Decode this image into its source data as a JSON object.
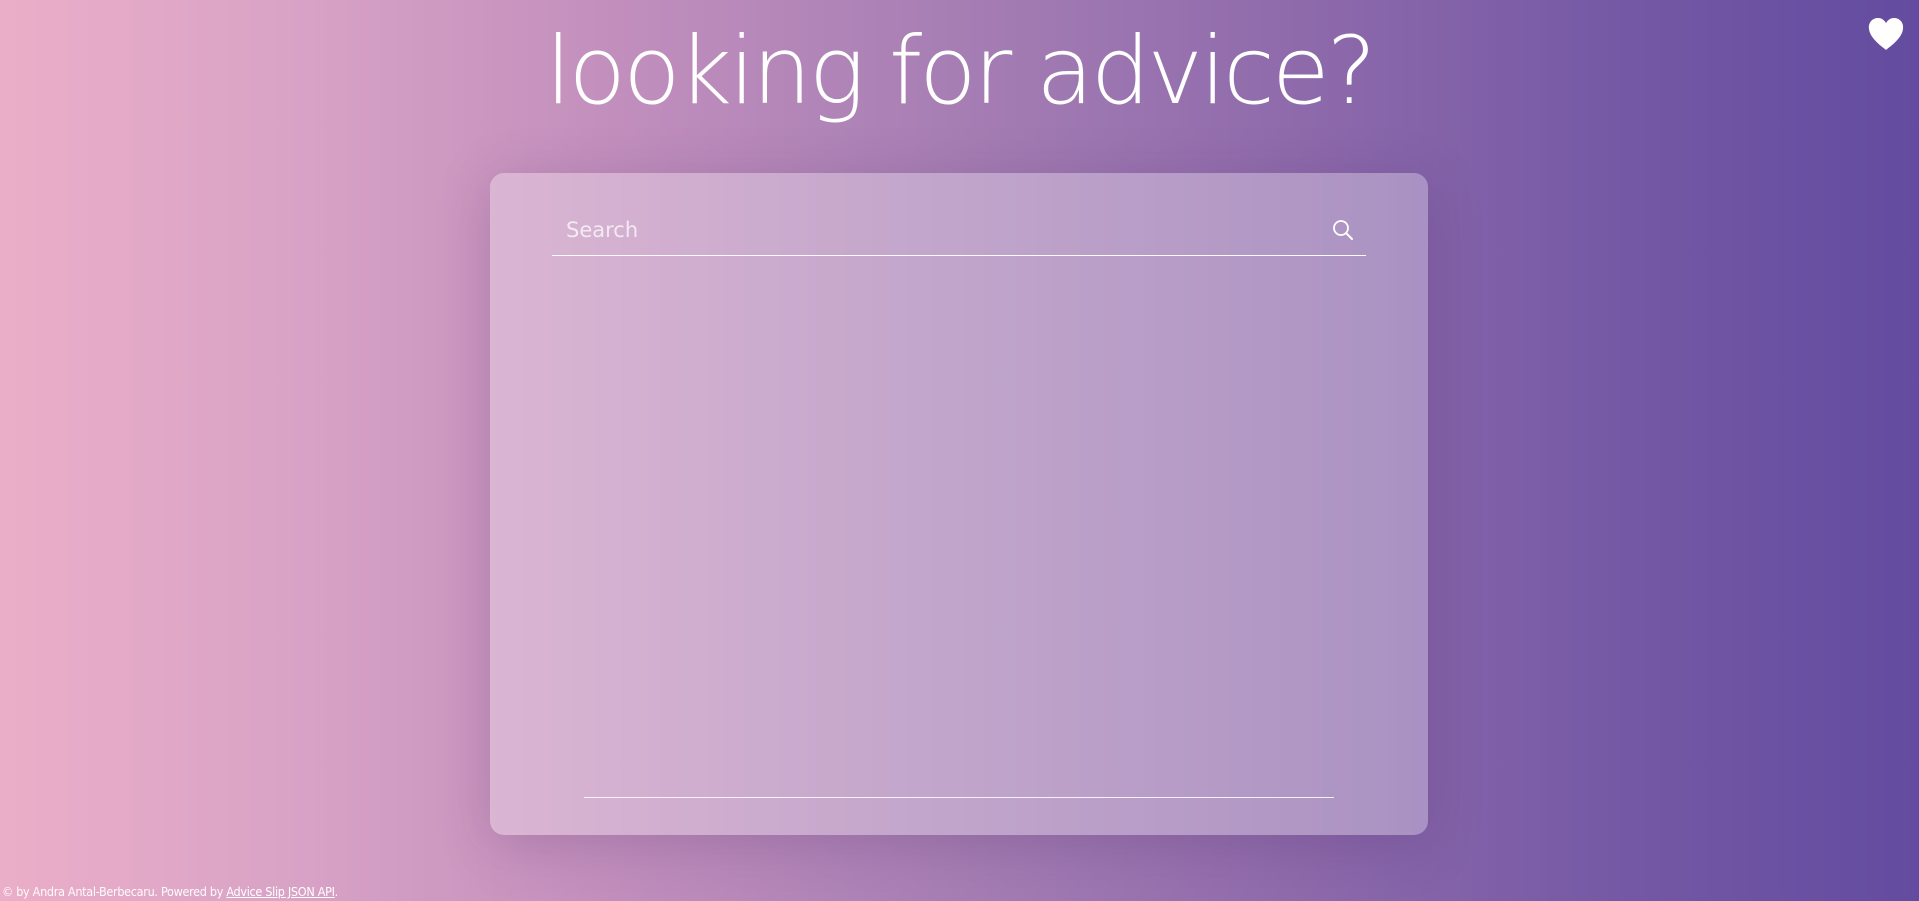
{
  "header": {
    "title": "looking for advice?",
    "favorites_icon": "heart-icon"
  },
  "search": {
    "placeholder": "Search",
    "value": "",
    "icon": "search-icon"
  },
  "advice": {
    "text": ""
  },
  "footer": {
    "credit": "© by Andra Antal-Berbecaru. Powered by ",
    "api_link": "Advice Slip JSON API",
    "end": "."
  },
  "colors": {
    "gradient_start": "#ebaec8",
    "gradient_end": "#634b9f",
    "text": "#ffffff"
  }
}
